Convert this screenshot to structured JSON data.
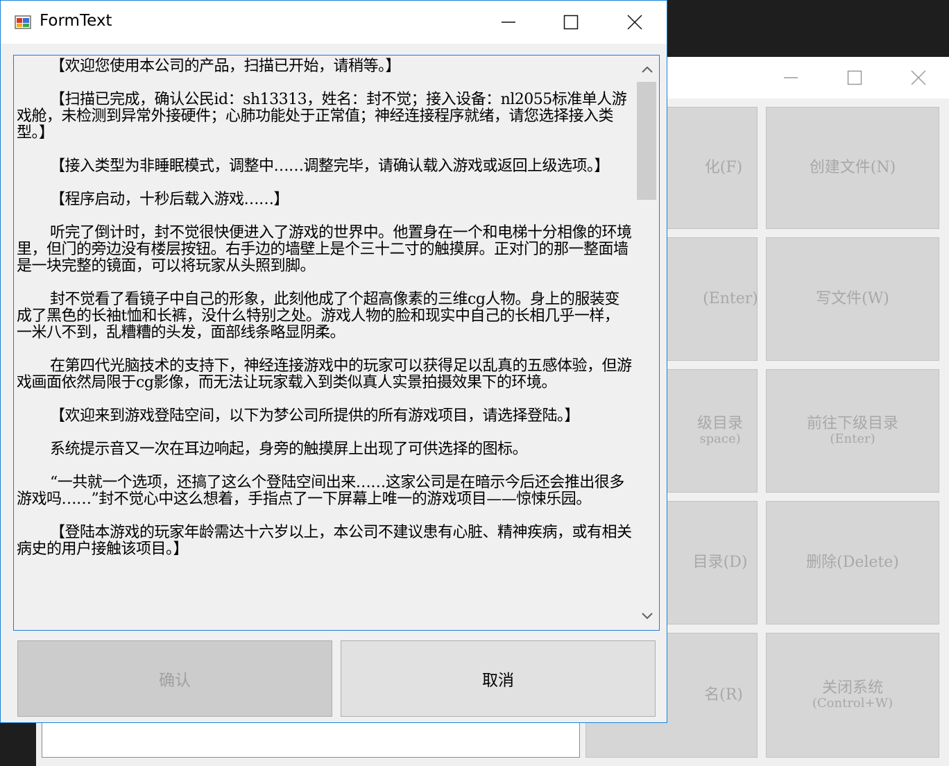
{
  "background_window": {
    "buttons": [
      {
        "label": "化(F)",
        "sub": ""
      },
      {
        "label": "创建文件(N)",
        "sub": ""
      },
      {
        "label": "(Enter)",
        "sub": ""
      },
      {
        "label": "写文件(W)",
        "sub": ""
      },
      {
        "label": "级目录",
        "sub": "space)"
      },
      {
        "label": "前往下级目录",
        "sub": "(Enter)"
      },
      {
        "label": "目录(D)",
        "sub": ""
      },
      {
        "label": "删除(Delete)",
        "sub": ""
      },
      {
        "label": "名(R)",
        "sub": ""
      },
      {
        "label": "关闭系统",
        "sub": "(Control+W)"
      }
    ]
  },
  "dialog": {
    "title": "FormText",
    "paragraphs": [
      "【欢迎您使用本公司的产品，扫描已开始，请稍等。】",
      "【扫描已完成，确认公民id：sh13313，姓名：封不觉；接入设备：nl2055标准单人游戏舱，未检测到异常外接硬件；心肺功能处于正常值；神经连接程序就绪，请您选择接入类型。】",
      "【接入类型为非睡眠模式，调整中……调整完毕，请确认载入游戏或返回上级选项。】",
      "【程序启动，十秒后载入游戏……】",
      "听完了倒计时，封不觉很快便进入了游戏的世界中。他置身在一个和电梯十分相像的环境里，但门的旁边没有楼层按钮。右手边的墙壁上是个三十二寸的触摸屏。正对门的那一整面墙是一块完整的镜面，可以将玩家从头照到脚。",
      "封不觉看了看镜子中自己的形象，此刻他成了个超高像素的三维cg人物。身上的服装变成了黑色的长袖t恤和长裤，没什么特别之处。游戏人物的脸和现实中自己的长相几乎一样，一米八不到，乱糟糟的头发，面部线条略显阴柔。",
      "在第四代光脑技术的支持下，神经连接游戏中的玩家可以获得足以乱真的五感体验，但游戏画面依然局限于cg影像，而无法让玩家载入到类似真人实景拍摄效果下的环境。",
      "【欢迎来到游戏登陆空间，以下为梦公司所提供的所有游戏项目，请选择登陆。】",
      "系统提示音又一次在耳边响起，身旁的触摸屏上出现了可供选择的图标。",
      "“一共就一个选项，还搞了这么个登陆空间出来……这家公司是在暗示今后还会推出很多游戏吗……”封不觉心中这么想着，手指点了一下屏幕上唯一的游戏项目——惊悚乐园。",
      "【登陆本游戏的玩家年龄需达十六岁以上，本公司不建议患有心脏、精神疾病，或有相关病史的用户接触该项目。】"
    ],
    "confirm_label": "确认",
    "cancel_label": "取消"
  }
}
